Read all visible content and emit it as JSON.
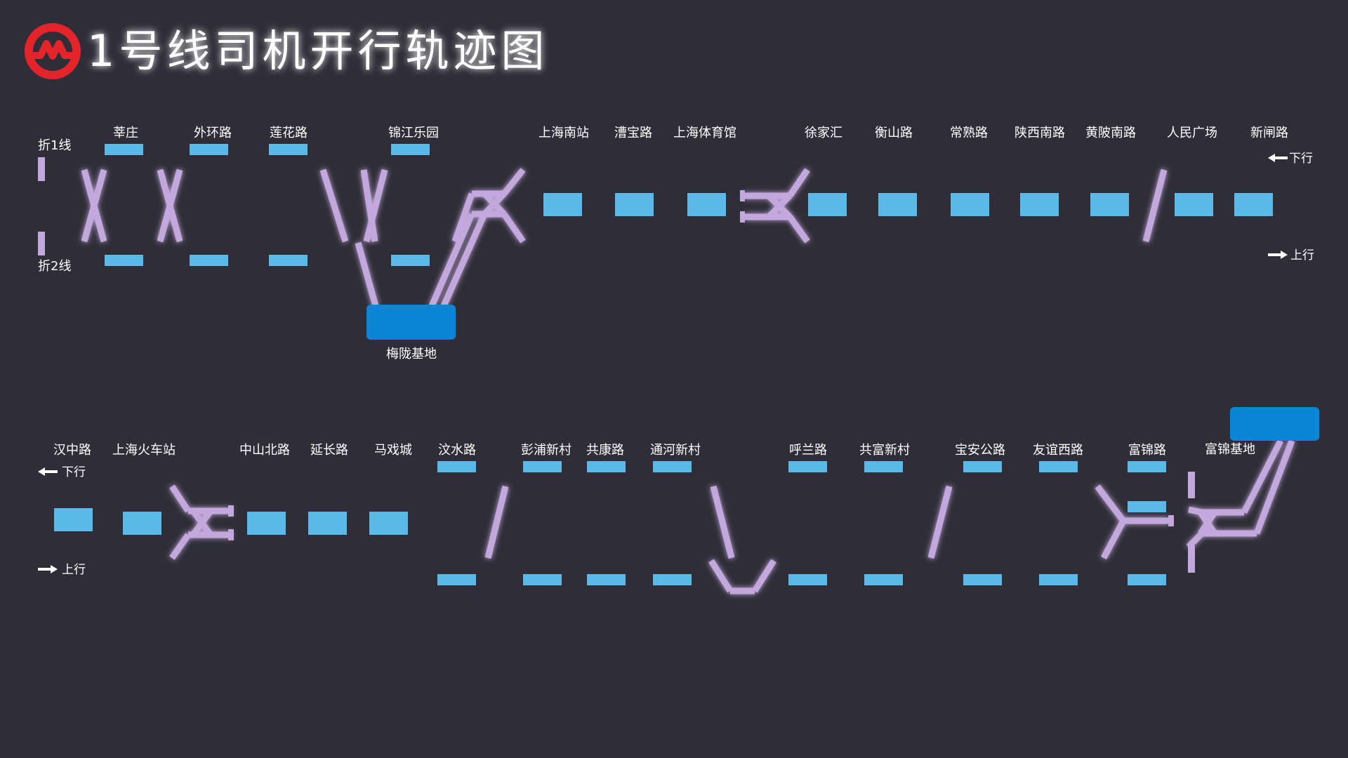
{
  "title": "1号线司机开行轨迹图",
  "logo": {
    "icon": "shanghai-metro-logo",
    "color": "#e3242b"
  },
  "colors": {
    "background": "#2f2e38",
    "track": "#c2a8dc",
    "platform": "#5bb9e8",
    "depot": "#0a86d6"
  },
  "upper": {
    "turnback_1": "折1线",
    "turnback_2": "折2线",
    "down_label": "下行",
    "up_label": "上行",
    "depot": "梅陇基地",
    "stations": [
      "莘庄",
      "外环路",
      "莲花路",
      "锦江乐园",
      "上海南站",
      "漕宝路",
      "上海体育馆",
      "徐家汇",
      "衡山路",
      "常熟路",
      "陕西南路",
      "黄陂南路",
      "人民广场",
      "新闸路"
    ]
  },
  "lower": {
    "down_label": "下行",
    "up_label": "上行",
    "depot": "富锦基地",
    "stations": [
      "汉中路",
      "上海火车站",
      "中山北路",
      "延长路",
      "马戏城",
      "汶水路",
      "彭浦新村",
      "共康路",
      "通河新村",
      "呼兰路",
      "共富新村",
      "宝安公路",
      "友谊西路",
      "富锦路"
    ]
  }
}
